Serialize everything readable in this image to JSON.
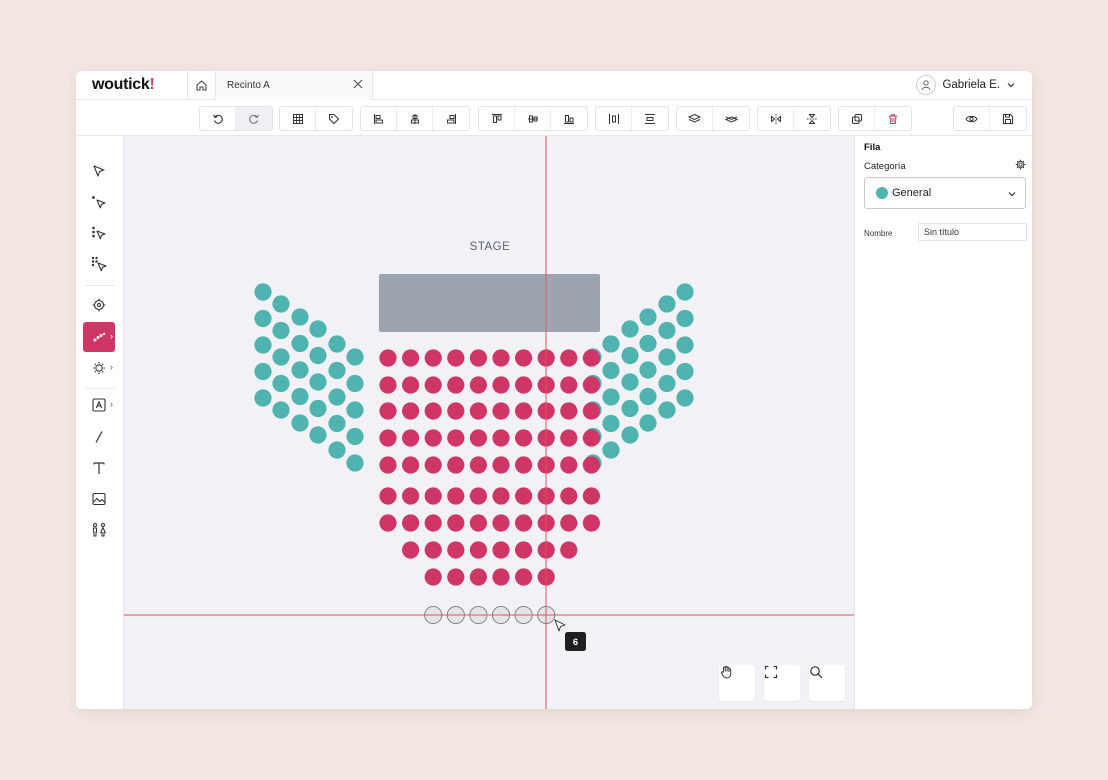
{
  "app": {
    "logo_text": "woutick",
    "logo_mark": "!"
  },
  "tabs": [
    {
      "label": "Recinto A",
      "active": true
    }
  ],
  "user": {
    "name": "Gabriela E."
  },
  "canvas": {
    "stage_label": "STAGE",
    "tooltip_count": "6",
    "colors": {
      "teal": "#4fb3b0",
      "crimson": "#cf3666",
      "stage": "#9ca4b0",
      "guide": "#e8505b"
    }
  },
  "panel": {
    "title": "Fila",
    "category_label": "Categoría",
    "category_value": "General",
    "category_color": "#4fb3b0",
    "name_label": "Nombre",
    "name_value": "Sin título"
  }
}
